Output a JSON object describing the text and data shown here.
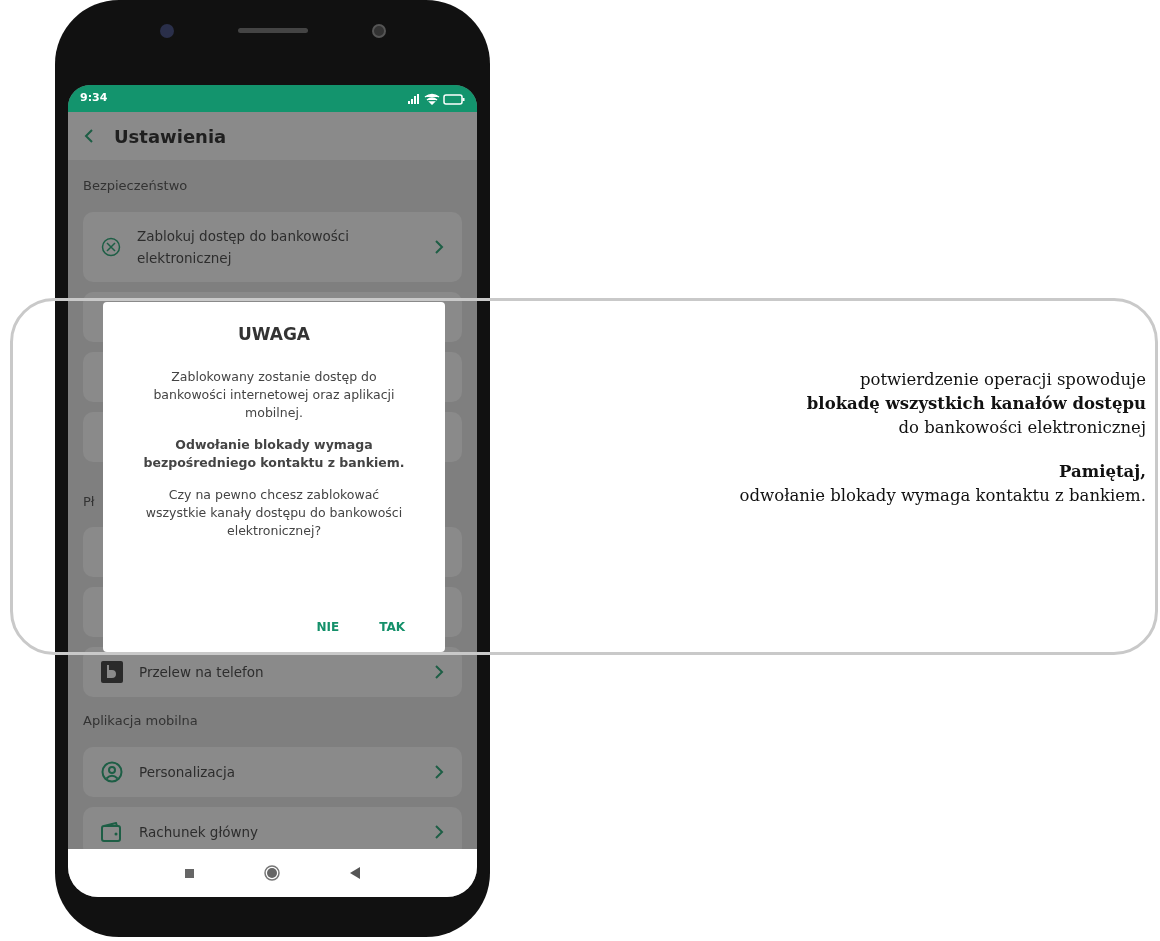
{
  "status_bar": {
    "time": "9:34"
  },
  "header": {
    "title": "Ustawienia"
  },
  "sections": [
    {
      "title": "Bezpieczeństwo",
      "items": [
        {
          "kind": "block",
          "label": "Zablokuj dostęp do bankowości elektronicznej"
        },
        {
          "kind": "covered"
        },
        {
          "kind": "covered"
        },
        {
          "kind": "covered"
        }
      ]
    },
    {
      "title": "Pł",
      "items": [
        {
          "kind": "covered"
        },
        {
          "kind": "covered"
        },
        {
          "kind": "blik",
          "label": "Przelew na telefon"
        }
      ]
    },
    {
      "title": "Aplikacja mobilna",
      "items": [
        {
          "kind": "person",
          "label": "Personalizacja"
        },
        {
          "kind": "wallet",
          "label": "Rachunek główny"
        }
      ]
    }
  ],
  "dialog": {
    "title": "UWAGA",
    "paragraphs": [
      {
        "text": "Zablokowany zostanie dostęp do bankowości internetowej oraz aplikacji mobilnej.",
        "bold": false
      },
      {
        "text": "Odwołanie blokady wymaga bezpośredniego kontaktu z bankiem.",
        "bold": true
      },
      {
        "text": "Czy na pewno chcesz zablokować wszystkie kanały dostępu do bankowości elektronicznej?",
        "bold": false
      }
    ],
    "buttons": [
      "NIE",
      "TAK"
    ]
  },
  "annotation": {
    "blocks": [
      [
        {
          "text": "potwierdzenie operacji spowoduje",
          "bold": false
        },
        {
          "text": "blokadę wszystkich kanałów dostępu",
          "bold": true
        },
        {
          "text": "do bankowości elektronicznej",
          "bold": false
        }
      ],
      [
        {
          "text": "Pamiętaj,",
          "bold": true
        },
        {
          "text": "odwołanie blokady wymaga kontaktu z bankiem.",
          "bold": false
        }
      ]
    ]
  }
}
